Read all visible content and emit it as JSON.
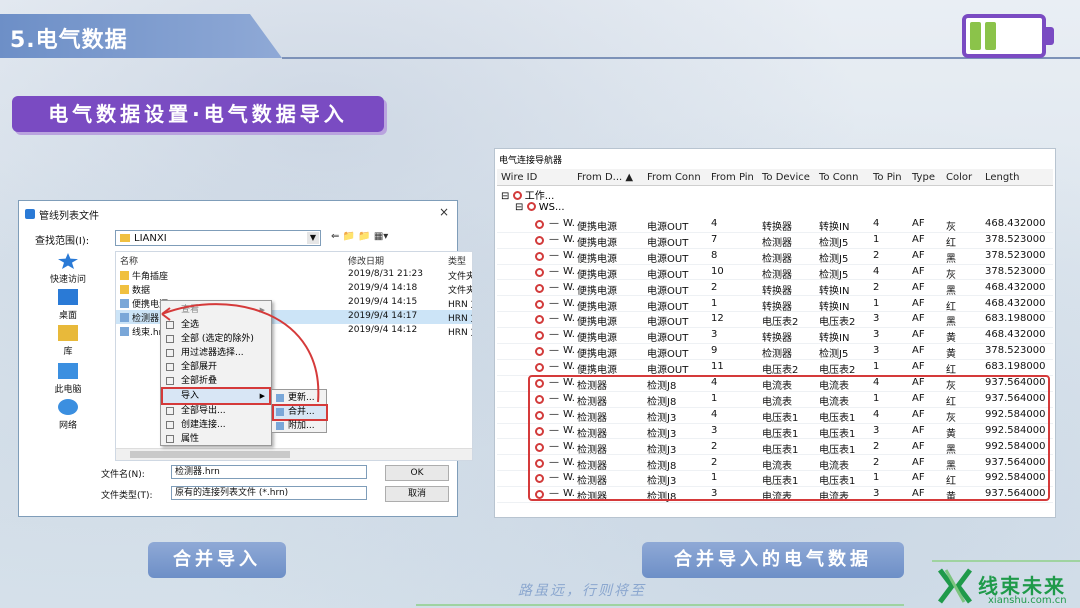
{
  "header": {
    "title": "5.电气数据"
  },
  "section_title": "电气数据设置·电气数据导入",
  "dialog": {
    "title": "管线列表文件",
    "close": "×",
    "lookin_label": "查找范围(I):",
    "lookin_value": "LIANXI",
    "nav_icons": "⇐ 📁 📁 ▦▾",
    "places": [
      {
        "label": "快速访问"
      },
      {
        "label": "桌面"
      },
      {
        "label": "库"
      },
      {
        "label": "此电脑"
      },
      {
        "label": "网络"
      }
    ],
    "columns": {
      "name": "名称",
      "modified": "修改日期",
      "type": "类型"
    },
    "files": [
      {
        "name": "牛角插座",
        "modified": "2019/8/31 21:23",
        "type": "文件夹",
        "kind": "folder"
      },
      {
        "name": "数据",
        "modified": "2019/9/4 14:18",
        "type": "文件夹",
        "kind": "folder"
      },
      {
        "name": "便携电源.hrn",
        "modified": "2019/9/4 14:15",
        "type": "HRN 文",
        "kind": "file"
      },
      {
        "name": "检测器.hrn",
        "modified": "2019/9/4 14:17",
        "type": "HRN 文",
        "kind": "file"
      },
      {
        "name": "线束.hrn",
        "modified": "2019/9/4 14:12",
        "type": "HRN 文",
        "kind": "file"
      }
    ],
    "filename_label": "文件名(N):",
    "filename_value": "检测器.hrn",
    "filetype_label": "文件类型(T):",
    "filetype_value": "原有的连接列表文件 (*.hrn)",
    "ok_label": "OK",
    "cancel_label": "取消"
  },
  "context_menu": {
    "items": [
      "查看",
      "全选",
      "全部 (选定的除外)",
      "用过滤器选择...",
      "全部展开",
      "全部折叠",
      "导入",
      "全部导出...",
      "创建连接...",
      "属性"
    ],
    "submenu": [
      "更新...",
      "合并...",
      "附加..."
    ]
  },
  "table": {
    "panel_title": "电气连接导航器",
    "columns": [
      "Wire ID",
      "From D...",
      "From Conn",
      "From Pin",
      "To Device",
      "To Conn",
      "To Pin",
      "Type",
      "Color",
      "Length"
    ],
    "tree_rows": [
      "工作...",
      "WS..."
    ],
    "rows": [
      [
        "W.",
        "便携电源",
        "电源OUT",
        "4",
        "转换器",
        "转换IN",
        "4",
        "AF",
        "灰",
        "468.432000"
      ],
      [
        "W.",
        "便携电源",
        "电源OUT",
        "7",
        "检测器",
        "检测J5",
        "1",
        "AF",
        "红",
        "378.523000"
      ],
      [
        "W.",
        "便携电源",
        "电源OUT",
        "8",
        "检测器",
        "检测J5",
        "2",
        "AF",
        "黑",
        "378.523000"
      ],
      [
        "W.",
        "便携电源",
        "电源OUT",
        "10",
        "检测器",
        "检测J5",
        "4",
        "AF",
        "灰",
        "378.523000"
      ],
      [
        "W.",
        "便携电源",
        "电源OUT",
        "2",
        "转换器",
        "转换IN",
        "2",
        "AF",
        "黑",
        "468.432000"
      ],
      [
        "W.",
        "便携电源",
        "电源OUT",
        "1",
        "转换器",
        "转换IN",
        "1",
        "AF",
        "红",
        "468.432000"
      ],
      [
        "W.",
        "便携电源",
        "电源OUT",
        "12",
        "电压表2",
        "电压表2",
        "3",
        "AF",
        "黑",
        "683.198000"
      ],
      [
        "W.",
        "便携电源",
        "电源OUT",
        "3",
        "转换器",
        "转换IN",
        "3",
        "AF",
        "黄",
        "468.432000"
      ],
      [
        "W.",
        "便携电源",
        "电源OUT",
        "9",
        "检测器",
        "检测J5",
        "3",
        "AF",
        "黄",
        "378.523000"
      ],
      [
        "W.",
        "便携电源",
        "电源OUT",
        "11",
        "电压表2",
        "电压表2",
        "1",
        "AF",
        "红",
        "683.198000"
      ],
      [
        "W.",
        "检测器",
        "检测J8",
        "4",
        "电流表",
        "电流表",
        "4",
        "AF",
        "灰",
        "937.564000"
      ],
      [
        "W.",
        "检测器",
        "检测J8",
        "1",
        "电流表",
        "电流表",
        "1",
        "AF",
        "红",
        "937.564000"
      ],
      [
        "W.",
        "检测器",
        "检测J3",
        "4",
        "电压表1",
        "电压表1",
        "4",
        "AF",
        "灰",
        "992.584000"
      ],
      [
        "W.",
        "检测器",
        "检测J3",
        "3",
        "电压表1",
        "电压表1",
        "3",
        "AF",
        "黄",
        "992.584000"
      ],
      [
        "W.",
        "检测器",
        "检测J3",
        "2",
        "电压表1",
        "电压表1",
        "2",
        "AF",
        "黑",
        "992.584000"
      ],
      [
        "W.",
        "检测器",
        "检测J8",
        "2",
        "电流表",
        "电流表",
        "2",
        "AF",
        "黑",
        "937.564000"
      ],
      [
        "W.",
        "检测器",
        "检测J3",
        "1",
        "电压表1",
        "电压表1",
        "1",
        "AF",
        "红",
        "992.584000"
      ],
      [
        "W.",
        "检测器",
        "检测J8",
        "3",
        "电流表",
        "电流表",
        "3",
        "AF",
        "黄",
        "937.564000"
      ]
    ]
  },
  "captions": {
    "left": "合并导入",
    "right": "合并导入的电气数据"
  },
  "motto": "路虽远，行则将至",
  "logo": {
    "name": "线束未来",
    "url": "xianshu.com.cn"
  },
  "colors": {
    "accent": "#7a4bc2",
    "header": "#6d8fc7",
    "highlight": "#d53a3a",
    "brand": "#1f9a4a"
  }
}
